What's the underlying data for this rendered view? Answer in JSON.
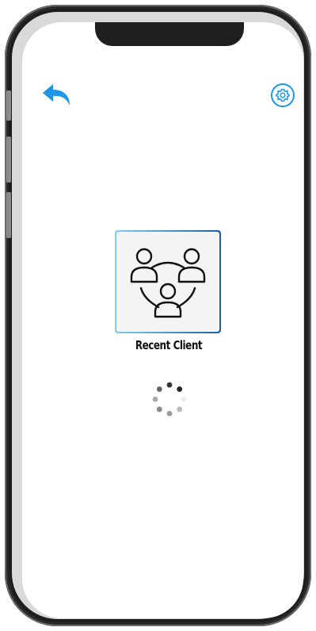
{
  "header": {
    "back_icon": "back-arrow-icon",
    "settings_icon": "gear-icon",
    "accent_color": "#1e96e6"
  },
  "main": {
    "card_icon": "group-users-icon",
    "card_label": "Recent Client",
    "loading_icon": "loading-spinner-icon"
  }
}
